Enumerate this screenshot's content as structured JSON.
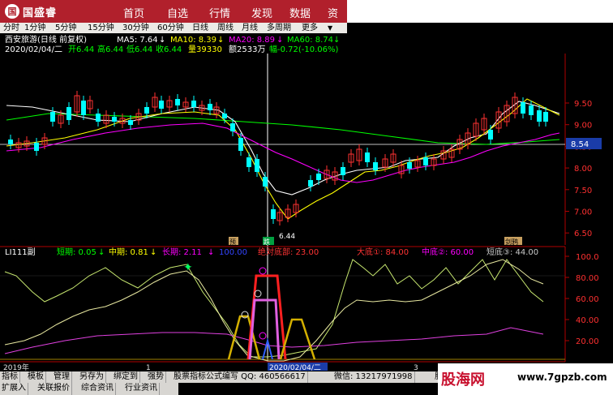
{
  "app": {
    "brand": "国盛睿",
    "brand_mark": "国"
  },
  "nav": {
    "items": [
      "首页",
      "自选",
      "行情",
      "发现",
      "数据",
      "资讯"
    ]
  },
  "periods": {
    "items": [
      "分时",
      "1分钟",
      "5分钟",
      "15分钟",
      "30分钟",
      "60分钟",
      "日线",
      "周线",
      "月线",
      "多周期",
      "更多"
    ],
    "active": "日线"
  },
  "stock": {
    "ma_line": "西安旅游(日线 前复权)",
    "ma5": "MA5: 7.64",
    "ma10": "MA10: 8.39",
    "ma20": "MA20: 8.89",
    "ma60": "MA60: 8.74",
    "info_date": "2020/02/04/二",
    "info_open": "开6.44",
    "info_high": "高6.44",
    "info_low": "低6.44",
    "info_close": "收6.44",
    "info_vol": "量39330",
    "info_amt": "额2533万",
    "info_chg": "幅-0.72(-10.06%)"
  },
  "price_axis": {
    "ticks": [
      "9.50",
      "9.00",
      "8.50",
      "8.00",
      "7.50",
      "7.00",
      "6.50"
    ],
    "current": "8.54",
    "low_label": "6.44"
  },
  "markers": {
    "yu": "预",
    "die": "跌",
    "chao": "剑鸦"
  },
  "indicator": {
    "name": "LI111副",
    "short": "短期: 0.05",
    "mid": "中期: 0.81",
    "long": "长期: 2.11",
    "v100": "100.00",
    "abs_bottom": "绝对底部: 23.00",
    "big_bottom": "大底①: 84.00",
    "mid_bottom": "中底②: 60.00",
    "short_bottom": "短底③: 44.00",
    "axis_ticks": [
      "100.0",
      "80.00",
      "60.00",
      "40.00",
      "20.00"
    ]
  },
  "time_axis": {
    "labels": [
      "2019年",
      "1",
      "2020/02/04/二",
      "3"
    ]
  },
  "toolbar": {
    "row1": [
      "指标",
      "模板",
      "管理",
      "另存为",
      "绑定到",
      "强势",
      "股票指标公式编写 QQ: 460566617",
      "微信: 13217971998",
      "股"
    ],
    "row2": [
      "扩展入",
      "关联报价",
      "综合资讯",
      "行业资讯"
    ]
  },
  "watermark": {
    "logo": "股海网",
    "url": "www.7gpzb.com"
  },
  "colors": {
    "up": "#ff3232",
    "down": "#00ffff",
    "ma5": "#ffffff",
    "ma10": "#ffff00",
    "ma20": "#ff00ff",
    "ma60": "#00ff00",
    "nav": "#b1202c"
  }
}
